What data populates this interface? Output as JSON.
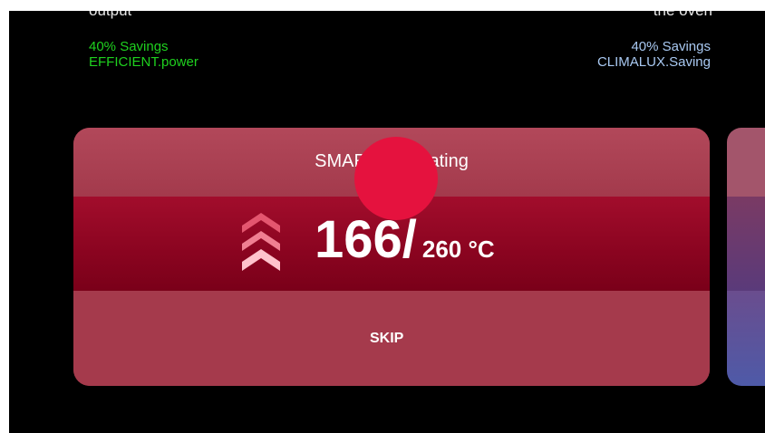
{
  "top": {
    "left_cut_text": "output",
    "right_cut_text": "the oven"
  },
  "left_info": {
    "savings": "40% Savings",
    "feature": "EFFICIENT.power",
    "color": "#1fd11f"
  },
  "right_info": {
    "savings": "40% Savings",
    "feature": "CLIMALUX.Saving",
    "color": "#a9c9f2"
  },
  "card": {
    "title": "SMART.Preheating",
    "current_temp": "166/",
    "target_temp": "260 °C",
    "skip_label": "SKIP",
    "icon": "heating-up-chevrons-icon",
    "accent": "#8a0420",
    "touch_color": "#e5123e"
  }
}
